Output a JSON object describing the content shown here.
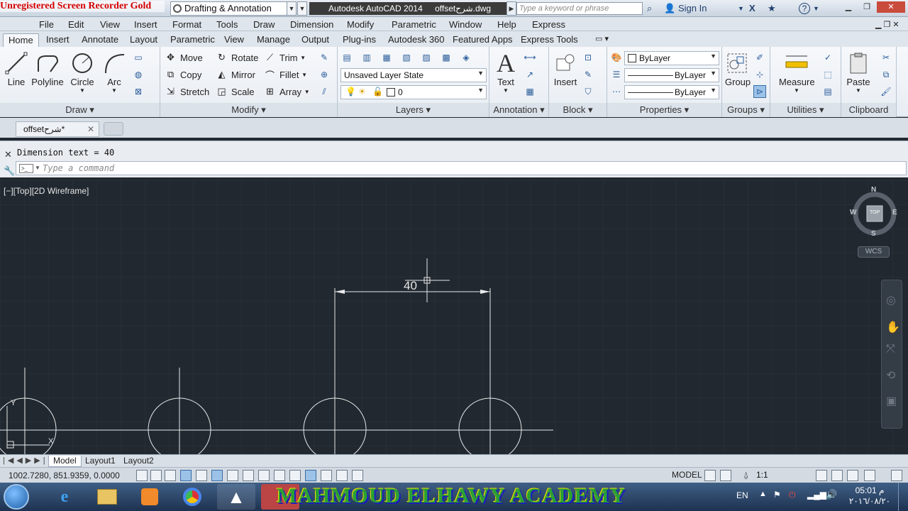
{
  "watermark_top": "Unregistered Screen Recorder Gold",
  "titlebar": {
    "workspace": "Drafting & Annotation",
    "app_title": "Autodesk AutoCAD 2014",
    "file_title": "offsetشرح.dwg",
    "search_placeholder": "Type a keyword or phrase",
    "sign_in": "Sign In"
  },
  "menu": [
    "File",
    "Edit",
    "View",
    "Insert",
    "Format",
    "Tools",
    "Draw",
    "Dimension",
    "Modify",
    "Parametric",
    "Window",
    "Help",
    "Express"
  ],
  "ribbon_tabs": [
    "Home",
    "Insert",
    "Annotate",
    "Layout",
    "Parametric",
    "View",
    "Manage",
    "Output",
    "Plug-ins",
    "Autodesk 360",
    "Featured Apps",
    "Express Tools"
  ],
  "active_tab": "Home",
  "draw_panel": {
    "title": "Draw",
    "line": "Line",
    "polyline": "Polyline",
    "circle": "Circle",
    "arc": "Arc"
  },
  "modify_panel": {
    "title": "Modify",
    "move": "Move",
    "rotate": "Rotate",
    "trim": "Trim",
    "copy": "Copy",
    "mirror": "Mirror",
    "fillet": "Fillet",
    "stretch": "Stretch",
    "scale": "Scale",
    "array": "Array"
  },
  "layers_panel": {
    "title": "Layers",
    "layer_state": "Unsaved Layer State",
    "current_layer": "0"
  },
  "annotation_panel": {
    "title": "Annotation",
    "text": "Text"
  },
  "block_panel": {
    "title": "Block",
    "insert": "Insert"
  },
  "properties_panel": {
    "title": "Properties",
    "color": "ByLayer",
    "linetype": "ByLayer",
    "lineweight": "ByLayer"
  },
  "groups_panel": {
    "title": "Groups",
    "group": "Group"
  },
  "utilities_panel": {
    "title": "Utilities",
    "measure": "Measure"
  },
  "clipboard_panel": {
    "title": "Clipboard",
    "paste": "Paste"
  },
  "doc_tab": "offsetشرح*",
  "command": {
    "history": "Dimension text = 40",
    "placeholder": "Type a command"
  },
  "viewport": {
    "label": "[−][Top][2D Wireframe]",
    "dimension_text": "40"
  },
  "viewcube": {
    "n": "N",
    "s": "S",
    "e": "E",
    "w": "W",
    "top": "TOP",
    "wcs": "WCS"
  },
  "layout_tabs": [
    "Model",
    "Layout1",
    "Layout2"
  ],
  "status": {
    "coords": "1002.7280, 851.9359, 0.0000",
    "space": "MODEL",
    "scale": "1:1"
  },
  "taskbar": {
    "banner": "MAHMOUD ELHAWY ACADEMY",
    "lang": "EN",
    "time": "05:01 م",
    "date": "٢٠١٦/٠٨/٢٠"
  }
}
